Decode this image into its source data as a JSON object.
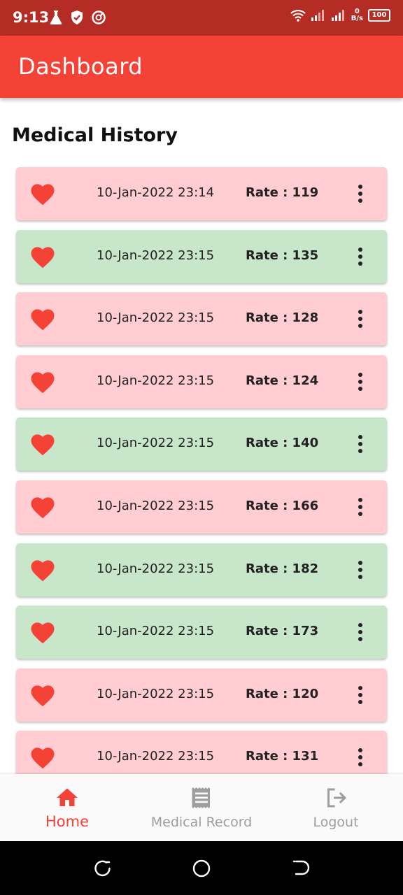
{
  "status_bar": {
    "time": "9:13",
    "speed_value": "0",
    "speed_unit": "B/s",
    "battery": "100"
  },
  "appbar": {
    "title": "Dashboard"
  },
  "section": {
    "title": "Medical History"
  },
  "history": [
    {
      "date": "10-Jan-2022 23:14",
      "rate": "Rate : 119",
      "color": "#ffcdd2"
    },
    {
      "date": "10-Jan-2022 23:15",
      "rate": "Rate : 135",
      "color": "#c8e6c9"
    },
    {
      "date": "10-Jan-2022 23:15",
      "rate": "Rate : 128",
      "color": "#ffcdd2"
    },
    {
      "date": "10-Jan-2022 23:15",
      "rate": "Rate : 124",
      "color": "#ffcdd2"
    },
    {
      "date": "10-Jan-2022 23:15",
      "rate": "Rate : 140",
      "color": "#c8e6c9"
    },
    {
      "date": "10-Jan-2022 23:15",
      "rate": "Rate : 166",
      "color": "#ffcdd2"
    },
    {
      "date": "10-Jan-2022 23:15",
      "rate": "Rate : 182",
      "color": "#c8e6c9"
    },
    {
      "date": "10-Jan-2022 23:15",
      "rate": "Rate : 173",
      "color": "#c8e6c9"
    },
    {
      "date": "10-Jan-2022 23:15",
      "rate": "Rate : 120",
      "color": "#ffcdd2"
    },
    {
      "date": "10-Jan-2022 23:15",
      "rate": "Rate : 131",
      "color": "#ffcdd2"
    }
  ],
  "bottom_nav": [
    {
      "label": "Home",
      "icon": "home-icon",
      "active": true
    },
    {
      "label": "Medical Record",
      "icon": "receipt-icon",
      "active": false
    },
    {
      "label": "Logout",
      "icon": "logout-icon",
      "active": false
    }
  ],
  "colors": {
    "accent": "#f44336",
    "status_bar": "#b52c24",
    "normal_rate": "#c8e6c9",
    "abnormal_rate": "#ffcdd2"
  }
}
